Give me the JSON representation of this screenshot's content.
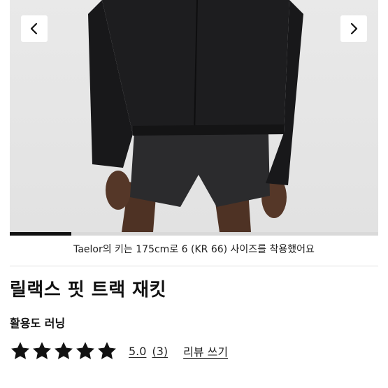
{
  "gallery": {
    "prev_icon": "chevron-left-icon",
    "next_icon": "chevron-right-icon",
    "progress": 0.167
  },
  "caption": "Taelor의 키는 175cm로 6 (KR 66) 사이즈를 착용했어요",
  "product": {
    "title": "릴랙스 핏 트랙 재킷",
    "activity": "활용도 러닝"
  },
  "rating": {
    "stars": 5,
    "score": "5.0",
    "count": "(3)",
    "write_review": "리뷰 쓰기"
  },
  "colors": {
    "jacket": "#1c1c1e",
    "shorts": "#2a2a2c",
    "skin": "#5a3a2a",
    "background": "#e6e6e6"
  }
}
